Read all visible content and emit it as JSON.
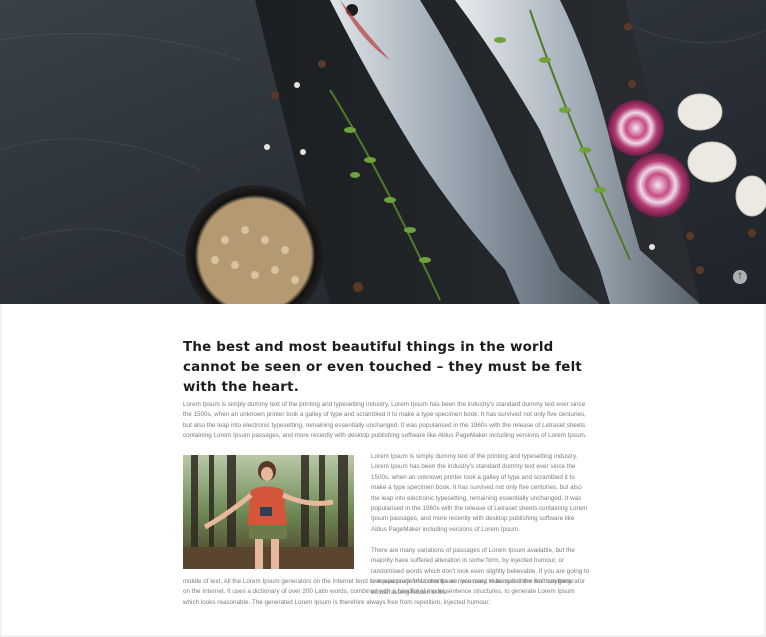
{
  "article": {
    "headline": "The best and most beautiful things in the world cannot be seen or even touched – they must be felt with the heart.",
    "intro": "Lorem Ipsum is simply dummy text of the printing and typesetting industry. Lorem Ipsum has been the industry's standard dummy text ever since the 1500s, when an unknown printer took a galley of type and scrambled it to make a type specimen book. It has survived not only five centuries, but also the leap into electronic typesetting, remaining essentially unchanged. It was popularised in the 1960s with the release of Letraset sheets containing Lorem Ipsum passages, and more recently with desktop publishing software like Aldus PageMaker including versions of Lorem Ipsum.",
    "side_paragraph": "Lorem Ipsum is simply dummy text of the printing and typesetting industry. Lorem Ipsum has been the industry's standard dummy text ever since the 1500s, when an unknown printer took a galley of type and scrambled it to make a type specimen book. It has survived not only five centuries, but also the leap into electronic typesetting, remaining essentially unchanged. It was popularised in the 1960s with the release of Letraset sheets containing Lorem Ipsum passages, and more recently with desktop publishing software like Aldus PageMaker including versions of Lorem Ipsum.",
    "variations_start": "There are many variations of passages of Lorem Ipsum available, but the majority have suffered alteration in some form, by injected humour, or randomised words which don't look even slightly believable. If you are going to use a passage of Lorem Ipsum, you need to be sure there isn't anything embarrassing hidden in the",
    "variations_end": "middle of text. All the Lorem Ipsum generators on the Internet tend to repeat predefined chunks as necessary, making this the first true generator on the Internet. It uses a dictionary of over 200 Latin words, combined with a handful of model sentence structures, to generate Lorem Ipsum which looks reasonable. The generated Lorem Ipsum is therefore always free from repetition, injected humour."
  },
  "icons": {
    "scroll_top": "arrow-up-icon",
    "scroll_top_glyph": "↑"
  }
}
